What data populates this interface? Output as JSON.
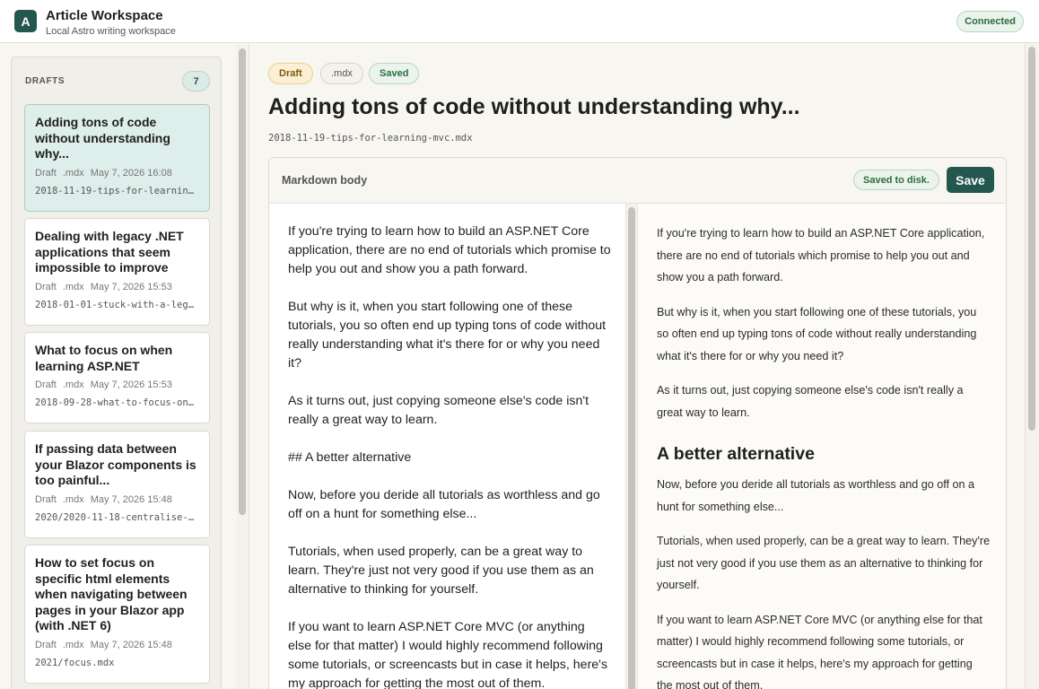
{
  "app": {
    "logo_letter": "A",
    "title": "Article Workspace",
    "subtitle": "Local Astro writing workspace",
    "status": "Connected"
  },
  "sidebar": {
    "heading": "DRAFTS",
    "count": "7",
    "items": [
      {
        "title": "Adding tons of code without understanding why...",
        "status": "Draft",
        "ext": ".mdx",
        "date": "May 7, 2026 16:08",
        "path": "2018-11-19-tips-for-learning-mvc.mdx",
        "active": true
      },
      {
        "title": "Dealing with legacy .NET applications that seem impossible to improve",
        "status": "Draft",
        "ext": ".mdx",
        "date": "May 7, 2026 15:53",
        "path": "2018-01-01-stuck-with-a-legacy-app.mdx",
        "active": false
      },
      {
        "title": "What to focus on when learning ASP.NET",
        "status": "Draft",
        "ext": ".mdx",
        "date": "May 7, 2026 15:53",
        "path": "2018-09-28-what-to-focus-on.mdx",
        "active": false
      },
      {
        "title": "If passing data between your Blazor components is too painful...",
        "status": "Draft",
        "ext": ".mdx",
        "date": "May 7, 2026 15:48",
        "path": "2020/2020-11-18-centralise-state.mdx",
        "active": false
      },
      {
        "title": "How to set focus on specific html elements when navigating between pages in your Blazor app (with .NET 6)",
        "status": "Draft",
        "ext": ".mdx",
        "date": "May 7, 2026 15:48",
        "path": "2021/focus.mdx",
        "active": false
      }
    ]
  },
  "article": {
    "status_badge": "Draft",
    "ext_badge": ".mdx",
    "saved_badge": "Saved",
    "title": "Adding tons of code without understanding why...",
    "path": "2018-11-19-tips-for-learning-mvc.mdx"
  },
  "editor": {
    "label": "Markdown body",
    "saved_status": "Saved to disk.",
    "save_label": "Save",
    "source": [
      "If you're trying to learn how to build an ASP.NET Core application, there are no end of tutorials which promise to help you out and show you a path forward.",
      "But why is it, when you start following one of these tutorials, you so often end up typing tons of code without really understanding what it's there for or why you need it?",
      "As it turns out, just copying someone else's code isn't really a great way to learn.",
      "## A better alternative",
      "Now, before you deride all tutorials as worthless and go off on a hunt for something else...",
      "Tutorials, when used properly, can be a great way to learn. They're just not very good if you use them as an alternative to thinking for yourself.",
      "If you want to learn ASP.NET Core MVC (or anything else for that matter) I would highly recommend following some tutorials, or screencasts but in case it helps, here's my approach for getting the most out of them."
    ],
    "preview": {
      "p1": "If you're trying to learn how to build an ASP.NET Core application, there are no end of tutorials which promise to help you out and show you a path forward.",
      "p2": "But why is it, when you start following one of these tutorials, you so often end up typing tons of code without really understanding what it's there for or why you need it?",
      "p3": "As it turns out, just copying someone else's code isn't really a great way to learn.",
      "h2": "A better alternative",
      "p4": "Now, before you deride all tutorials as worthless and go off on a hunt for something else...",
      "p5": "Tutorials, when used properly, can be a great way to learn. They're just not very good if you use them as an alternative to thinking for yourself.",
      "p6": "If you want to learn ASP.NET Core MVC (or anything else for that matter) I would highly recommend following some tutorials, or screencasts but in case it helps, here's my approach for getting the most out of them."
    }
  }
}
